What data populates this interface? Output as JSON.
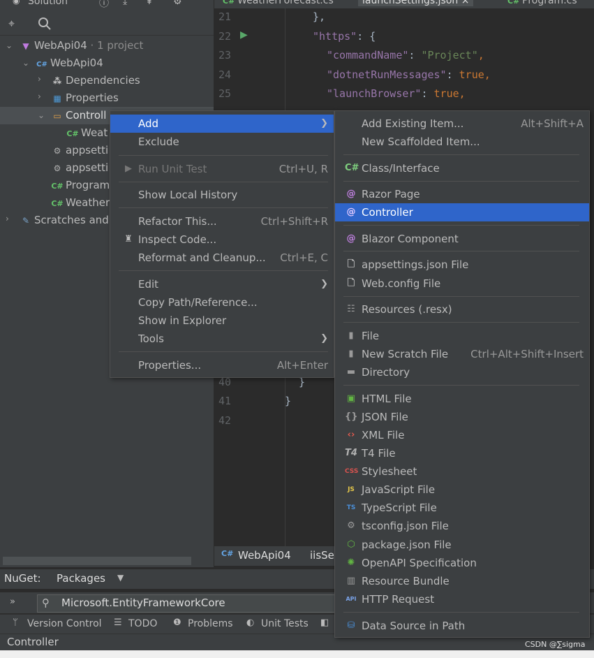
{
  "solution_panel": {
    "header": "Solution",
    "tree": [
      {
        "label": "WebApi04",
        "suffix": "· 1 project",
        "icon": "solution-icon"
      },
      {
        "label": "WebApi04",
        "icon": "csharp-project-icon"
      },
      {
        "label": "Dependencies",
        "icon": "dependencies-icon"
      },
      {
        "label": "Properties",
        "icon": "properties-folder-icon"
      },
      {
        "label": "Controll",
        "icon": "folder-icon"
      },
      {
        "label": "Weat",
        "icon": "csharp-file-icon"
      },
      {
        "label": "appsetti",
        "icon": "json-settings-icon"
      },
      {
        "label": "appsetti",
        "icon": "json-settings-icon"
      },
      {
        "label": "Program",
        "icon": "csharp-file-icon"
      },
      {
        "label": "Weather",
        "icon": "csharp-file-icon"
      },
      {
        "label": "Scratches and",
        "icon": "scratches-icon"
      }
    ]
  },
  "editor": {
    "tabs": [
      "WeatherForecast.cs",
      "launchSettings.json",
      "Program.cs"
    ],
    "lines": [
      {
        "num": "21",
        "text": "},"
      },
      {
        "num": "22",
        "key": "\"https\"",
        "rest": ": {"
      },
      {
        "num": "23",
        "key": "\"commandName\"",
        "value": "\"Project\"",
        "kind": "string"
      },
      {
        "num": "24",
        "key": "\"dotnetRunMessages\"",
        "value": "true",
        "kind": "bool"
      },
      {
        "num": "25",
        "key": "\"launchBrowser\"",
        "value": "true",
        "kind": "bool"
      },
      {
        "num": "40",
        "text": "}"
      },
      {
        "num": "41",
        "text": "}"
      },
      {
        "num": "42",
        "text": ""
      }
    ],
    "breadcrumb": [
      "WebApi04",
      "iisSet"
    ]
  },
  "context_menu": {
    "items": [
      {
        "label": "Add",
        "has_submenu": true,
        "highlighted": true
      },
      {
        "label": "Exclude"
      },
      {
        "label": "Run Unit Test",
        "shortcut": "Ctrl+U, R",
        "disabled": true
      },
      {
        "label": "Show Local History"
      },
      {
        "label": "Refactor This...",
        "shortcut": "Ctrl+Shift+R"
      },
      {
        "label": "Inspect Code..."
      },
      {
        "label": "Reformat and Cleanup...",
        "shortcut": "Ctrl+E, C"
      },
      {
        "label": "Edit",
        "has_submenu": true
      },
      {
        "label": "Copy Path/Reference..."
      },
      {
        "label": "Show in Explorer"
      },
      {
        "label": "Tools",
        "has_submenu": true
      },
      {
        "label": "Properties...",
        "shortcut": "Alt+Enter"
      }
    ]
  },
  "add_submenu": {
    "items": [
      {
        "label": "Add Existing Item...",
        "shortcut": "Alt+Shift+A"
      },
      {
        "label": "New Scaffolded Item..."
      },
      {
        "label": "Class/Interface",
        "icon": "csharp-icon",
        "glyph": "C#"
      },
      {
        "label": "Razor Page",
        "icon": "razor-icon",
        "glyph": "@"
      },
      {
        "label": "Controller",
        "icon": "razor-icon",
        "glyph": "@",
        "highlighted": true
      },
      {
        "label": "Blazor Component",
        "icon": "blazor-icon",
        "glyph": "@"
      },
      {
        "label": "appsettings.json File",
        "icon": "file-icon"
      },
      {
        "label": "Web.config File",
        "icon": "file-icon"
      },
      {
        "label": "Resources (.resx)",
        "icon": "resources-icon"
      },
      {
        "label": "File",
        "icon": "file-icon"
      },
      {
        "label": "New Scratch File",
        "icon": "scratch-file-icon",
        "shortcut": "Ctrl+Alt+Shift+Insert"
      },
      {
        "label": "Directory",
        "icon": "directory-icon"
      },
      {
        "label": "HTML File",
        "icon": "html-file-icon"
      },
      {
        "label": "JSON File",
        "icon": "json-file-icon"
      },
      {
        "label": "XML File",
        "icon": "xml-file-icon"
      },
      {
        "label": "T4 File",
        "icon": "t4-file-icon",
        "glyph": "T4"
      },
      {
        "label": "Stylesheet",
        "icon": "css-file-icon"
      },
      {
        "label": "JavaScript File",
        "icon": "js-file-icon"
      },
      {
        "label": "TypeScript File",
        "icon": "ts-file-icon"
      },
      {
        "label": "tsconfig.json File",
        "icon": "tsconfig-icon"
      },
      {
        "label": "package.json File",
        "icon": "package-json-icon"
      },
      {
        "label": "OpenAPI Specification",
        "icon": "openapi-icon"
      },
      {
        "label": "Resource Bundle",
        "icon": "resource-bundle-icon"
      },
      {
        "label": "HTTP Request",
        "icon": "http-request-icon",
        "glyph": "API"
      },
      {
        "label": "Data Source in Path",
        "icon": "database-icon"
      }
    ]
  },
  "nuget": {
    "label": "NuGet:",
    "dropdown": "Packages"
  },
  "search": {
    "value": "Microsoft.EntityFrameworkCore"
  },
  "tool_strip": [
    "Version Control",
    "TODO",
    "Problems",
    "Unit Tests"
  ],
  "status_bar": {
    "text": "Controller"
  },
  "watermark": "CSDN @∑sigma",
  "colors": {
    "highlight": "#2f65ca",
    "panel": "#3c3f41",
    "editor_bg": "#2b2b2b"
  }
}
